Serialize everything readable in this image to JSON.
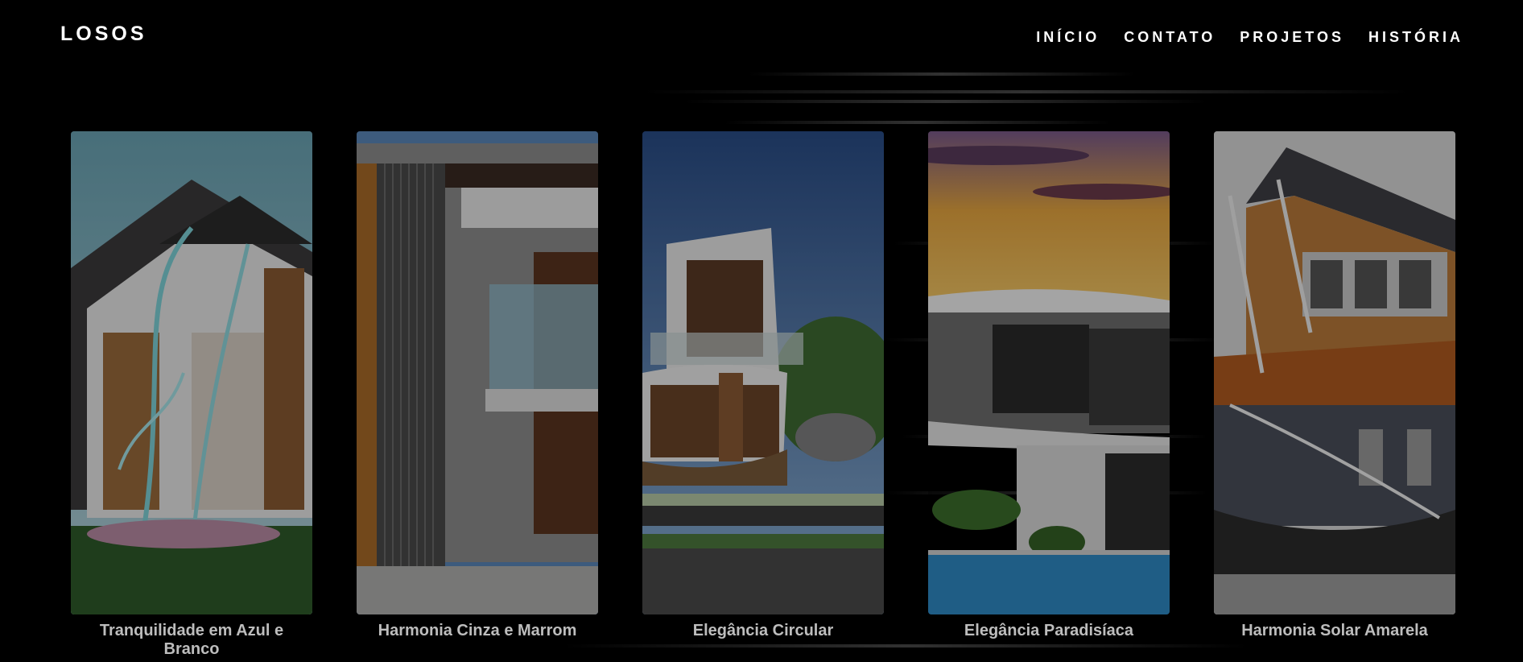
{
  "header": {
    "logo": "LOSOS",
    "nav": [
      "INÍCIO",
      "CONTATO",
      "PROJETOS",
      "HISTÓRIA"
    ]
  },
  "projects": [
    {
      "title": "Tranquilidade em Azul e Branco",
      "image": "house-blue-white-image"
    },
    {
      "title": "Harmonia Cinza e Marrom",
      "image": "house-gray-brown-image"
    },
    {
      "title": "Elegância Circular",
      "image": "house-circular-image"
    },
    {
      "title": "Elegância Paradisíaca",
      "image": "house-paradise-pool-image"
    },
    {
      "title": "Harmonia Solar Amarela",
      "image": "house-yellow-solar-image"
    }
  ]
}
